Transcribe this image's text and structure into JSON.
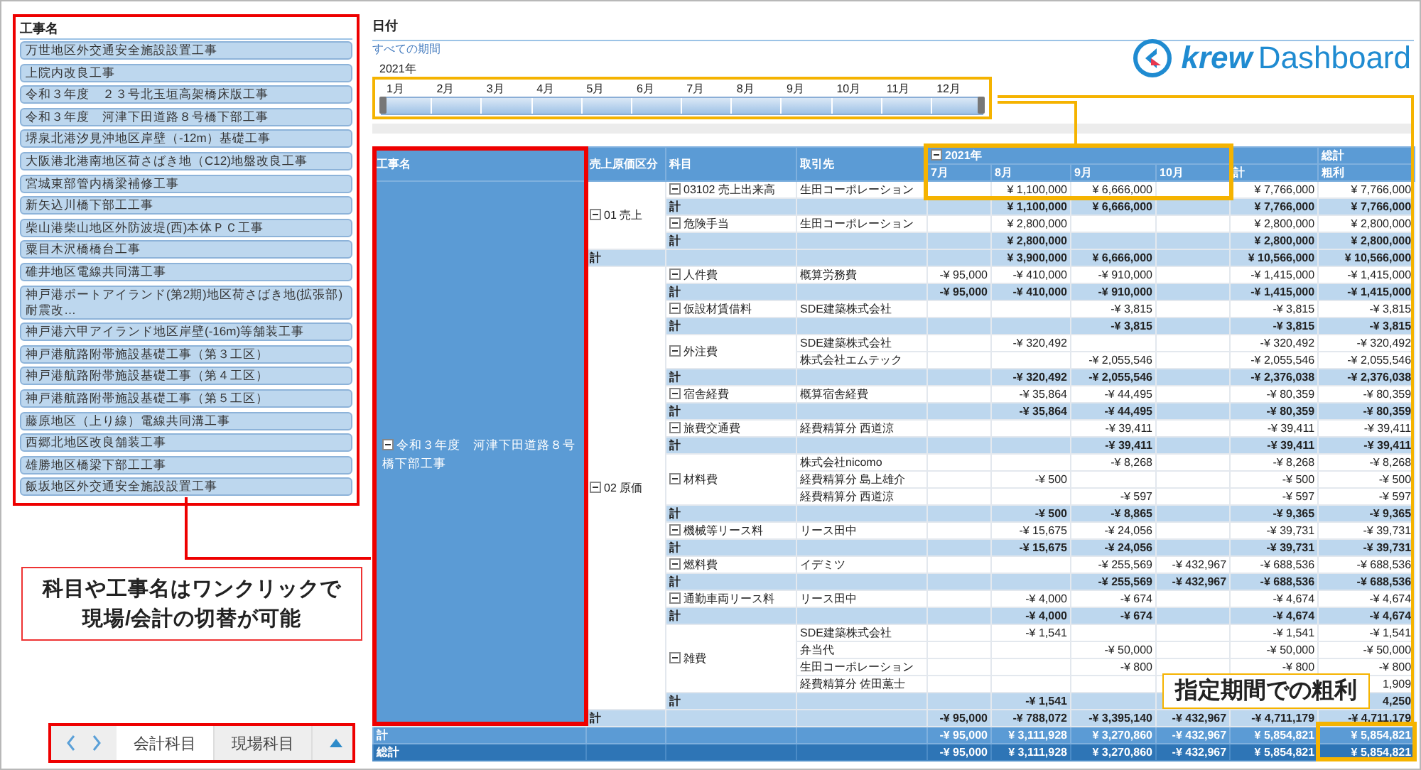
{
  "project_list": {
    "title": "工事名",
    "items": [
      {
        "label": "万世地区外交通安全施設設置工事"
      },
      {
        "label": "上院内改良工事"
      },
      {
        "label": "令和３年度　２３号北玉垣高架橋床版工事"
      },
      {
        "label": "令和３年度　河津下田道路８号橋下部工事"
      },
      {
        "label": "堺泉北港汐見沖地区岸壁（-12m）基礎工事"
      },
      {
        "label": "大阪港北港南地区荷さばき地（C12)地盤改良工事"
      },
      {
        "label": "宮城東部管内橋梁補修工事"
      },
      {
        "label": "新矢込川橋下部工工事"
      },
      {
        "label": "柴山港柴山地区外防波堤(西)本体ＰＣ工事"
      },
      {
        "label": "粟目木沢橋橋台工事"
      },
      {
        "label": "碓井地区電線共同溝工事"
      },
      {
        "label": "神戸港ポートアイランド(第2期)地区荷さばき地(拡張部)耐震改…"
      },
      {
        "label": "神戸港六甲アイランド地区岸壁(-16m)等舗装工事"
      },
      {
        "label": "神戸港航路附帯施設基礎工事（第３工区）"
      },
      {
        "label": "神戸港航路附帯施設基礎工事（第４工区）"
      },
      {
        "label": "神戸港航路附帯施設基礎工事（第５工区）"
      },
      {
        "label": "藤原地区（上り線）電線共同溝工事"
      },
      {
        "label": "西郷北地区改良舗装工事"
      },
      {
        "label": "雄勝地区橋梁下部工工事"
      },
      {
        "label": "飯坂地区外交通安全施設設置工事"
      }
    ]
  },
  "note_left": {
    "lines": [
      "科目や工事名はワンクリックで",
      "現場/会計の切替が可能"
    ]
  },
  "bottom_nav": {
    "tabs": [
      {
        "label": "会計科目",
        "selected": true
      },
      {
        "label": "現場科目",
        "selected": false
      }
    ]
  },
  "date_filter": {
    "title": "日付",
    "link": "すべての期間",
    "year": "2021年",
    "months": [
      "1月",
      "2月",
      "3月",
      "4月",
      "5月",
      "6月",
      "7月",
      "8月",
      "9月",
      "10月",
      "11月",
      "12月"
    ],
    "level": 1
  },
  "logo": {
    "brand": "krew",
    "product": "Dashboard"
  },
  "note_right": {
    "text": "指定期間での粗利"
  },
  "pivot": {
    "headers": {
      "columns": [
        "工事名",
        "売上原価区分",
        "科目",
        "取引先"
      ],
      "year": {
        "label": "2021年",
        "expanded": true
      },
      "months": [
        "7月",
        "8月",
        "9月",
        "10月"
      ],
      "total": "計",
      "grand": "総計",
      "grand_sub": "粗利"
    },
    "project": {
      "name": "令和３年度　河津下田道路８号橋下部工事",
      "expanded": true,
      "categories": [
        {
          "label": "01 売上",
          "expanded": true,
          "accounts": [
            {
              "label": "03102 売上出来高",
              "expanded": true,
              "vendors": [
                {
                  "name": "生田コーポレーション",
                  "values": {
                    "aug": "¥ 1,100,000",
                    "sep": "¥ 6,666,000",
                    "total": "¥ 7,766,000",
                    "gross": "¥ 7,766,000"
                  }
                }
              ],
              "subtotal": {
                "label": "計",
                "values": {
                  "aug": "¥ 1,100,000",
                  "sep": "¥ 6,666,000",
                  "total": "¥ 7,766,000",
                  "gross": "¥ 7,766,000"
                }
              }
            },
            {
              "label": "危険手当",
              "expanded": true,
              "vendors": [
                {
                  "name": "生田コーポレーション",
                  "values": {
                    "aug": "¥ 2,800,000",
                    "total": "¥ 2,800,000",
                    "gross": "¥ 2,800,000"
                  }
                }
              ],
              "subtotal": {
                "label": "計",
                "values": {
                  "aug": "¥ 2,800,000",
                  "total": "¥ 2,800,000",
                  "gross": "¥ 2,800,000"
                }
              }
            }
          ],
          "total": {
            "label": "計",
            "values": {
              "aug": "¥ 3,900,000",
              "sep": "¥ 6,666,000",
              "total": "¥ 10,566,000",
              "gross": "¥ 10,566,000"
            }
          }
        },
        {
          "label": "02 原価",
          "expanded": true,
          "accounts": [
            {
              "label": "人件費",
              "expanded": true,
              "vendors": [
                {
                  "name": "概算労務費",
                  "values": {
                    "jul": "-¥ 95,000",
                    "aug": "-¥ 410,000",
                    "sep": "-¥ 910,000",
                    "total": "-¥ 1,415,000",
                    "gross": "-¥ 1,415,000"
                  }
                }
              ],
              "subtotal": {
                "label": "計",
                "values": {
                  "jul": "-¥ 95,000",
                  "aug": "-¥ 410,000",
                  "sep": "-¥ 910,000",
                  "total": "-¥ 1,415,000",
                  "gross": "-¥ 1,415,000"
                }
              }
            },
            {
              "label": "仮設材賃借料",
              "expanded": true,
              "vendors": [
                {
                  "name": "SDE建築株式会社",
                  "values": {
                    "sep": "-¥ 3,815",
                    "total": "-¥ 3,815",
                    "gross": "-¥ 3,815"
                  }
                }
              ],
              "subtotal": {
                "label": "計",
                "values": {
                  "sep": "-¥ 3,815",
                  "total": "-¥ 3,815",
                  "gross": "-¥ 3,815"
                }
              }
            },
            {
              "label": "外注費",
              "expanded": true,
              "vendors": [
                {
                  "name": "SDE建築株式会社",
                  "values": {
                    "aug": "-¥ 320,492",
                    "total": "-¥ 320,492",
                    "gross": "-¥ 320,492"
                  }
                },
                {
                  "name": "株式会社エムテック",
                  "values": {
                    "sep": "-¥ 2,055,546",
                    "total": "-¥ 2,055,546",
                    "gross": "-¥ 2,055,546"
                  }
                }
              ],
              "subtotal": {
                "label": "計",
                "values": {
                  "aug": "-¥ 320,492",
                  "sep": "-¥ 2,055,546",
                  "total": "-¥ 2,376,038",
                  "gross": "-¥ 2,376,038"
                }
              }
            },
            {
              "label": "宿舎経費",
              "expanded": true,
              "vendors": [
                {
                  "name": "概算宿舎経費",
                  "values": {
                    "aug": "-¥ 35,864",
                    "sep": "-¥ 44,495",
                    "total": "-¥ 80,359",
                    "gross": "-¥ 80,359"
                  }
                }
              ],
              "subtotal": {
                "label": "計",
                "values": {
                  "aug": "-¥ 35,864",
                  "sep": "-¥ 44,495",
                  "total": "-¥ 80,359",
                  "gross": "-¥ 80,359"
                }
              }
            },
            {
              "label": "旅費交通費",
              "expanded": true,
              "vendors": [
                {
                  "name": "経費精算分 西道涼",
                  "values": {
                    "sep": "-¥ 39,411",
                    "total": "-¥ 39,411",
                    "gross": "-¥ 39,411"
                  }
                }
              ],
              "subtotal": {
                "label": "計",
                "values": {
                  "sep": "-¥ 39,411",
                  "total": "-¥ 39,411",
                  "gross": "-¥ 39,411"
                }
              }
            },
            {
              "label": "材料費",
              "expanded": true,
              "vendors": [
                {
                  "name": "株式会社nicomo",
                  "values": {
                    "sep": "-¥ 8,268",
                    "total": "-¥ 8,268",
                    "gross": "-¥ 8,268"
                  }
                },
                {
                  "name": "経費精算分 島上雄介",
                  "values": {
                    "aug": "-¥ 500",
                    "total": "-¥ 500",
                    "gross": "-¥ 500"
                  }
                },
                {
                  "name": "経費精算分 西道涼",
                  "values": {
                    "sep": "-¥ 597",
                    "total": "-¥ 597",
                    "gross": "-¥ 597"
                  }
                }
              ],
              "subtotal": {
                "label": "計",
                "values": {
                  "aug": "-¥ 500",
                  "sep": "-¥ 8,865",
                  "total": "-¥ 9,365",
                  "gross": "-¥ 9,365"
                }
              }
            },
            {
              "label": "機械等リース料",
              "expanded": true,
              "vendors": [
                {
                  "name": "リース田中",
                  "values": {
                    "aug": "-¥ 15,675",
                    "sep": "-¥ 24,056",
                    "total": "-¥ 39,731",
                    "gross": "-¥ 39,731"
                  }
                }
              ],
              "subtotal": {
                "label": "計",
                "values": {
                  "aug": "-¥ 15,675",
                  "sep": "-¥ 24,056",
                  "total": "-¥ 39,731",
                  "gross": "-¥ 39,731"
                }
              }
            },
            {
              "label": "燃料費",
              "expanded": true,
              "vendors": [
                {
                  "name": "イデミツ",
                  "values": {
                    "sep": "-¥ 255,569",
                    "oct": "-¥ 432,967",
                    "total": "-¥ 688,536",
                    "gross": "-¥ 688,536"
                  }
                }
              ],
              "subtotal": {
                "label": "計",
                "values": {
                  "sep": "-¥ 255,569",
                  "oct": "-¥ 432,967",
                  "total": "-¥ 688,536",
                  "gross": "-¥ 688,536"
                }
              }
            },
            {
              "label": "通勤車両リース料",
              "expanded": true,
              "vendors": [
                {
                  "name": "リース田中",
                  "values": {
                    "aug": "-¥ 4,000",
                    "sep": "-¥ 674",
                    "total": "-¥ 4,674",
                    "gross": "-¥ 4,674"
                  }
                }
              ],
              "subtotal": {
                "label": "計",
                "values": {
                  "aug": "-¥ 4,000",
                  "sep": "-¥ 674",
                  "total": "-¥ 4,674",
                  "gross": "-¥ 4,674"
                }
              }
            },
            {
              "label": "雑費",
              "expanded": true,
              "vendors": [
                {
                  "name": "SDE建築株式会社",
                  "values": {
                    "aug": "-¥ 1,541",
                    "total": "-¥ 1,541",
                    "gross": "-¥ 1,541"
                  }
                },
                {
                  "name": "弁当代",
                  "values": {
                    "sep": "-¥ 50,000",
                    "total": "-¥ 50,000",
                    "gross": "-¥ 50,000"
                  }
                },
                {
                  "name": "生田コーポレーション",
                  "values": {
                    "sep": "-¥ 800",
                    "total": "-¥ 800",
                    "gross": "-¥ 800"
                  }
                },
                {
                  "name": "経費精算分 佐田薫士",
                  "values": {
                    "gross": "1,909"
                  }
                }
              ],
              "subtotal": {
                "label": "計",
                "values": {
                  "aug": "-¥ 1,541",
                  "gross": "4,250"
                }
              }
            }
          ],
          "total": {
            "label": "計",
            "values": {
              "jul": "-¥ 95,000",
              "aug": "-¥ 788,072",
              "sep": "-¥ 3,395,140",
              "oct": "-¥ 432,967",
              "total": "-¥ 4,711,179",
              "gross": "-¥ 4,711,179"
            }
          }
        }
      ],
      "total": {
        "label": "計",
        "values": {
          "jul": "-¥ 95,000",
          "aug": "¥ 3,111,928",
          "sep": "¥ 3,270,860",
          "oct": "-¥ 432,967",
          "total": "¥ 5,854,821",
          "gross": "¥ 5,854,821"
        }
      }
    },
    "grand_total": {
      "label": "総計",
      "values": {
        "jul": "-¥ 95,000",
        "aug": "¥ 3,111,928",
        "sep": "¥ 3,270,860",
        "oct": "-¥ 432,967",
        "total": "¥ 5,854,821",
        "gross": "¥ 5,854,821"
      }
    }
  }
}
